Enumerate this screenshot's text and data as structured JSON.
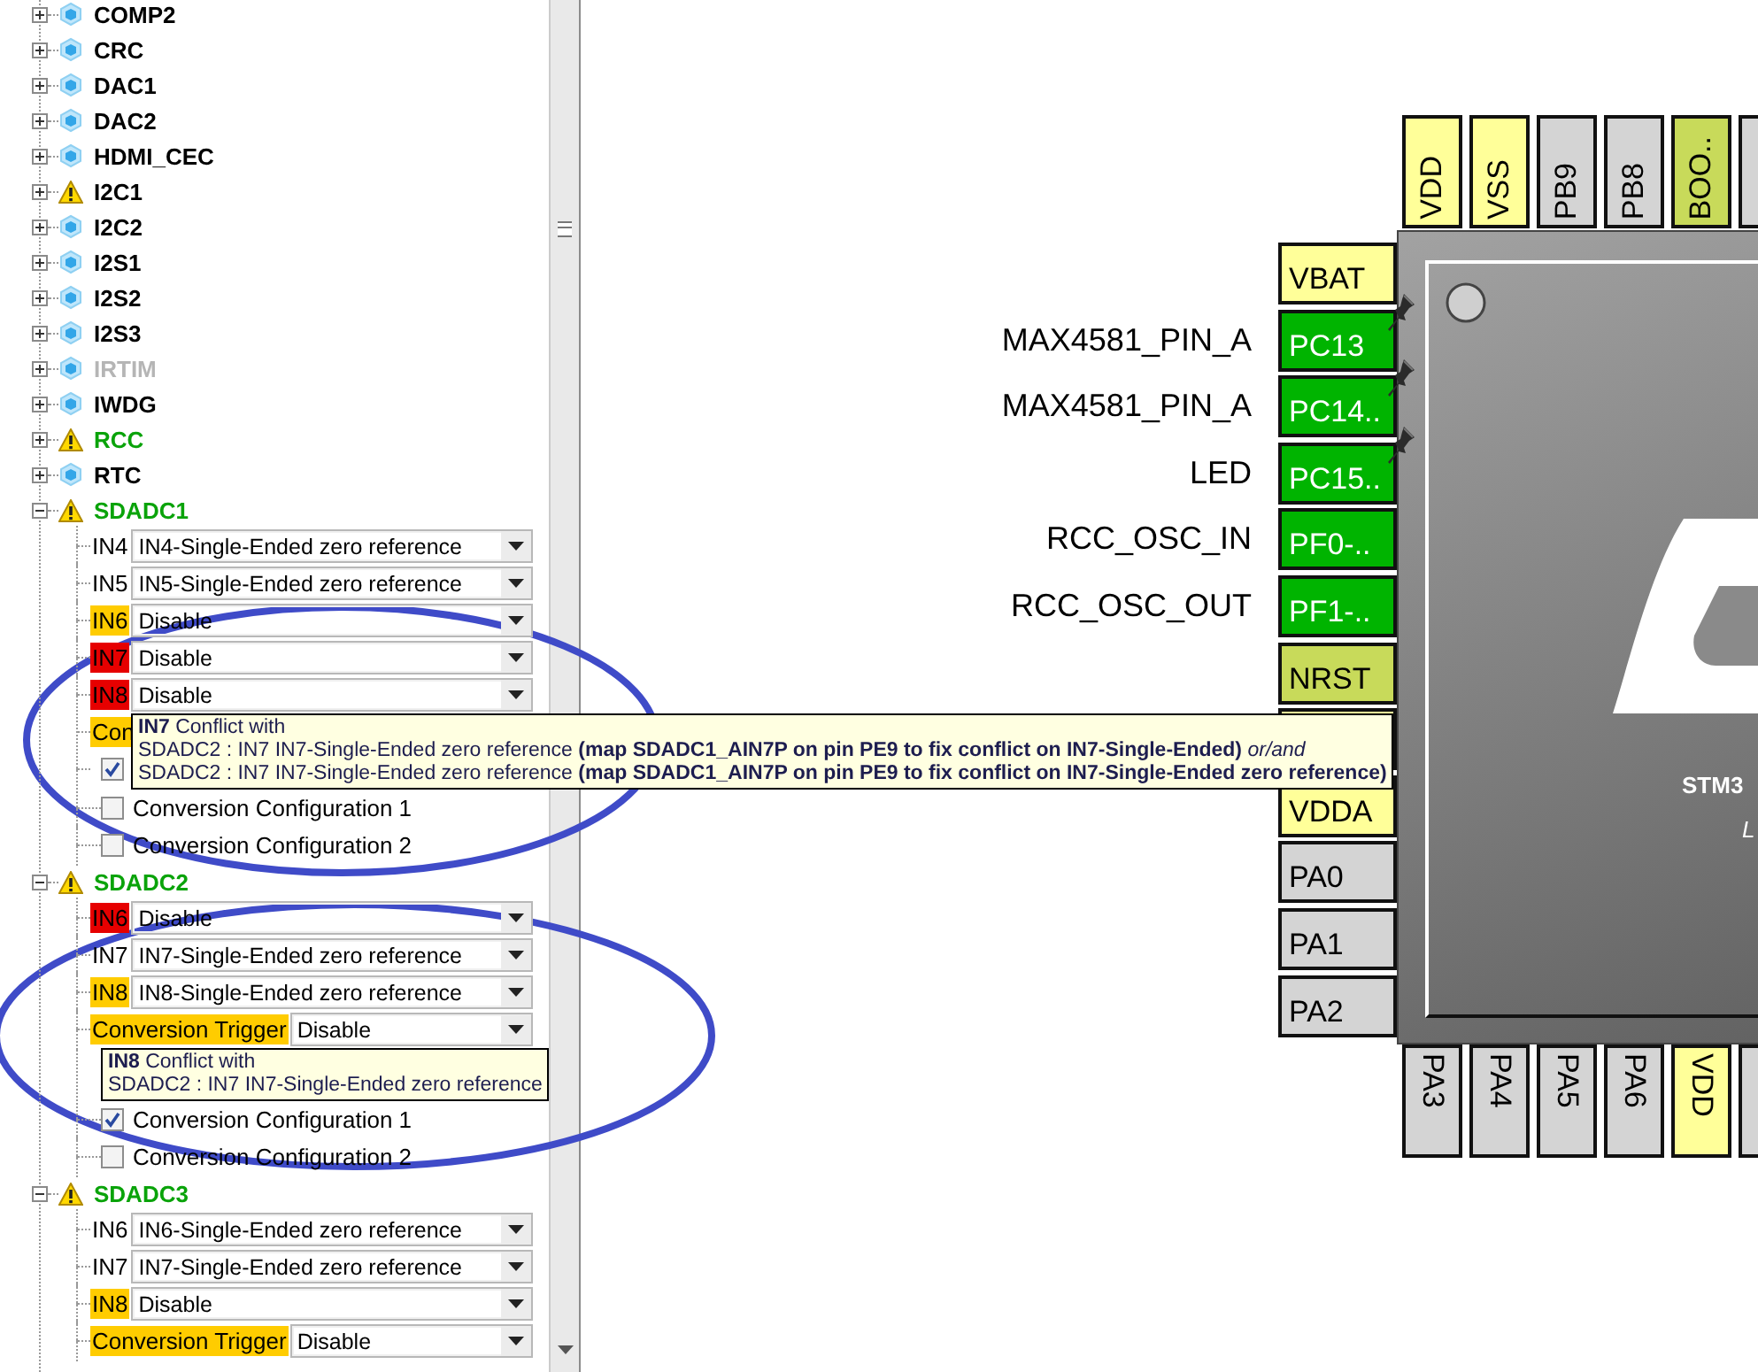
{
  "peripherals": [
    {
      "name": "COMP2",
      "warning": false,
      "configured": false,
      "disabled": false,
      "expanded": false
    },
    {
      "name": "CRC",
      "warning": false,
      "configured": false,
      "disabled": false,
      "expanded": false
    },
    {
      "name": "DAC1",
      "warning": false,
      "configured": false,
      "disabled": false,
      "expanded": false
    },
    {
      "name": "DAC2",
      "warning": false,
      "configured": false,
      "disabled": false,
      "expanded": false
    },
    {
      "name": "HDMI_CEC",
      "warning": false,
      "configured": false,
      "disabled": false,
      "expanded": false
    },
    {
      "name": "I2C1",
      "warning": true,
      "configured": false,
      "disabled": false,
      "expanded": false
    },
    {
      "name": "I2C2",
      "warning": false,
      "configured": false,
      "disabled": false,
      "expanded": false
    },
    {
      "name": "I2S1",
      "warning": false,
      "configured": false,
      "disabled": false,
      "expanded": false
    },
    {
      "name": "I2S2",
      "warning": false,
      "configured": false,
      "disabled": false,
      "expanded": false
    },
    {
      "name": "I2S3",
      "warning": false,
      "configured": false,
      "disabled": false,
      "expanded": false
    },
    {
      "name": "IRTIM",
      "warning": false,
      "configured": false,
      "disabled": true,
      "expanded": false
    },
    {
      "name": "IWDG",
      "warning": false,
      "configured": false,
      "disabled": false,
      "expanded": false
    },
    {
      "name": "RCC",
      "warning": true,
      "configured": true,
      "disabled": false,
      "expanded": false
    },
    {
      "name": "RTC",
      "warning": false,
      "configured": false,
      "disabled": false,
      "expanded": false
    },
    {
      "name": "SDADC1",
      "warning": true,
      "configured": true,
      "disabled": false,
      "expanded": true,
      "items": [
        {
          "kind": "select",
          "label": "IN4",
          "warning": false,
          "error": false,
          "value": "IN4-Single-Ended zero reference"
        },
        {
          "kind": "select",
          "label": "IN5",
          "warning": false,
          "error": false,
          "value": "IN5-Single-Ended zero reference"
        },
        {
          "kind": "select",
          "label": "IN6",
          "warning": true,
          "error": false,
          "value": "Disable"
        },
        {
          "kind": "select",
          "label": "IN7",
          "warning": false,
          "error": true,
          "value": "Disable"
        },
        {
          "kind": "select",
          "label": "IN8",
          "warning": false,
          "error": true,
          "value": "Disable"
        },
        {
          "kind": "tooltip",
          "title": "**IN7** Conflict with",
          "lines": [
            "SDADC2 : IN7 IN7-Single-Ended zero reference **(map SDADC1_AIN7P on pin PE9 to fix conflict on IN7-Single-Ended)** *or/and*",
            "SDADC2 : IN7 IN7-Single-Ended zero reference **(map SDADC1_AIN7P on pin PE9 to fix conflict on IN7-Single-Ended zero reference)**"
          ],
          "peeking": [
            {
              "kind": "label",
              "label": "Con",
              "warning": true,
              "error": false
            },
            {
              "kind": "checkbox",
              "checked": true
            }
          ]
        },
        {
          "kind": "checkbox",
          "label": "Conversion Configuration 1",
          "checked": false
        },
        {
          "kind": "checkbox",
          "label": "Conversion Configuration 2",
          "checked": false
        }
      ]
    },
    {
      "name": "SDADC2",
      "warning": true,
      "configured": true,
      "disabled": false,
      "expanded": true,
      "items": [
        {
          "kind": "select",
          "label": "IN6",
          "warning": false,
          "error": true,
          "value": "Disable"
        },
        {
          "kind": "select",
          "label": "IN7",
          "warning": false,
          "error": false,
          "value": "IN7-Single-Ended zero reference"
        },
        {
          "kind": "select",
          "label": "IN8",
          "warning": true,
          "error": false,
          "value": "IN8-Single-Ended zero reference"
        },
        {
          "kind": "select",
          "label": "Conversion Trigger",
          "warning": true,
          "error": false,
          "value": "Disable"
        },
        {
          "kind": "tooltip",
          "title": "**IN8** Conflict with",
          "lines": [
            "SDADC2 : IN7 IN7-Single-Ended zero reference"
          ]
        },
        {
          "kind": "checkbox",
          "label": "Conversion Configuration 1",
          "checked": true
        },
        {
          "kind": "checkbox",
          "label": "Conversion Configuration 2",
          "checked": false
        }
      ]
    },
    {
      "name": "SDADC3",
      "warning": true,
      "configured": true,
      "disabled": false,
      "expanded": true,
      "items": [
        {
          "kind": "select",
          "label": "IN6",
          "warning": false,
          "error": false,
          "value": "IN6-Single-Ended zero reference"
        },
        {
          "kind": "select",
          "label": "IN7",
          "warning": false,
          "error": false,
          "value": "IN7-Single-Ended zero reference"
        },
        {
          "kind": "select",
          "label": "IN8",
          "warning": true,
          "error": false,
          "value": "Disable"
        },
        {
          "kind": "select",
          "label": "Conversion Trigger",
          "warning": true,
          "error": false,
          "value": "Disable"
        }
      ]
    }
  ],
  "chip": {
    "label_line_1": "STM3",
    "label_line_2": "L",
    "top_pins": [
      {
        "name": "VDD",
        "kind": "power"
      },
      {
        "name": "VSS",
        "kind": "power"
      },
      {
        "name": "PB9",
        "kind": "free"
      },
      {
        "name": "PB8",
        "kind": "free"
      },
      {
        "name": "BOO..",
        "kind": "reset"
      },
      {
        "kind": "free"
      }
    ],
    "left_pins": [
      {
        "name": "VBAT",
        "kind": "power",
        "pinned": false
      },
      {
        "name": "PC13",
        "kind": "assigned",
        "signal": "MAX4581_PIN_A",
        "pinned": true
      },
      {
        "name": "PC14..",
        "kind": "assigned",
        "signal": "MAX4581_PIN_A",
        "pinned": true
      },
      {
        "name": "PC15..",
        "kind": "assigned",
        "signal": "LED",
        "pinned": true
      },
      {
        "name": "PF0-..",
        "kind": "assigned",
        "signal": "RCC_OSC_IN",
        "pinned": false
      },
      {
        "name": "PF1-..",
        "kind": "assigned",
        "signal": "RCC_OSC_OUT",
        "pinned": false
      },
      {
        "name": "NRST",
        "kind": "reset",
        "pinned": false
      },
      {
        "kind": "power"
      },
      {
        "name": "VDDA",
        "kind": "power",
        "pinned": false
      },
      {
        "name": "PA0",
        "kind": "free",
        "pinned": false
      },
      {
        "name": "PA1",
        "kind": "free",
        "pinned": false
      },
      {
        "name": "PA2",
        "kind": "free",
        "pinned": false
      }
    ],
    "bottom_pins": [
      {
        "name": "PA3",
        "kind": "free"
      },
      {
        "name": "PA4",
        "kind": "free"
      },
      {
        "name": "PA5",
        "kind": "free"
      },
      {
        "name": "PA6",
        "kind": "free"
      },
      {
        "name": "VDD",
        "kind": "power"
      },
      {
        "kind": "free"
      }
    ]
  },
  "annotation_marks": [
    {
      "kind": "ellipse"
    },
    {
      "kind": "ellipse"
    }
  ]
}
